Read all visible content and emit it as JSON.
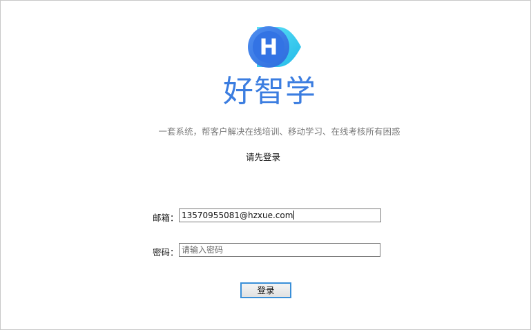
{
  "brand": {
    "logo_icon": "h-play-logo-icon",
    "logo_letter": "H",
    "name": "好智学",
    "slogan": "一套系统，帮客户解决在线培训、移动学习、在线考核所有困惑",
    "colors": {
      "brand_blue": "#3b7de0",
      "logo_cyan": "#38d4f0"
    }
  },
  "login": {
    "prompt": "请先登录",
    "email_label": "邮箱：",
    "email_value": "13570955081@hzxue.com",
    "password_label": "密码：",
    "password_placeholder": "请输入密码",
    "submit_label": "登录"
  }
}
